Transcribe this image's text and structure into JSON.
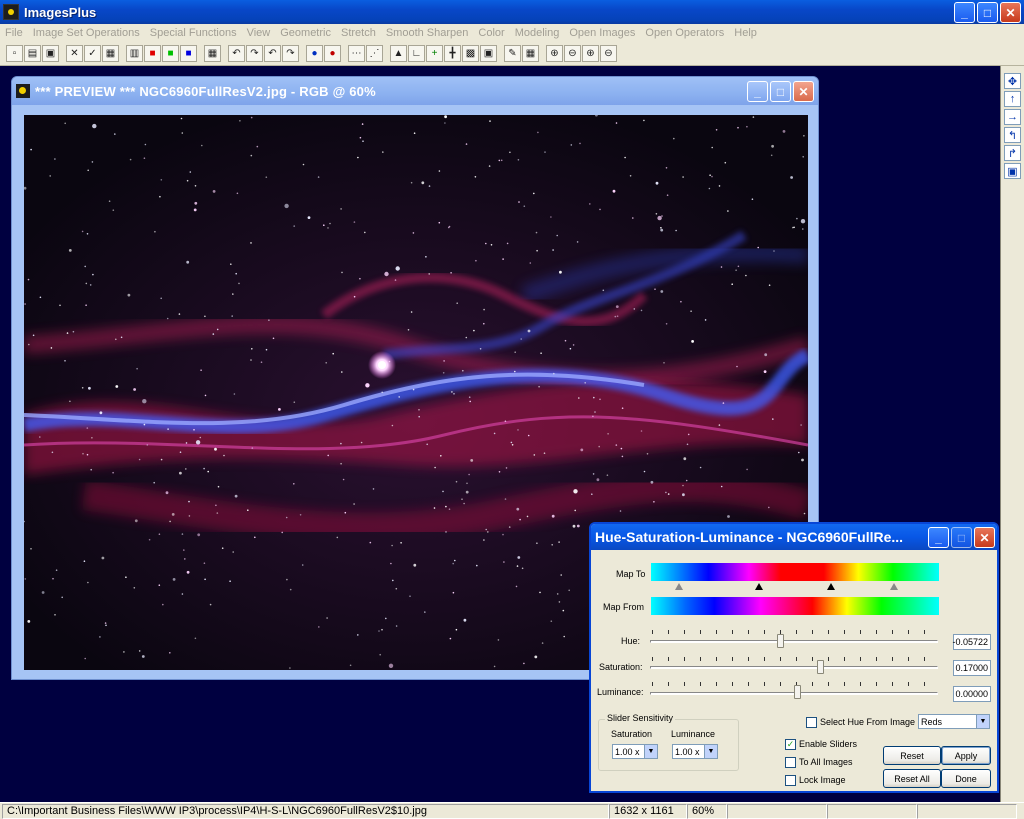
{
  "app": {
    "title": "ImagesPlus",
    "menu": [
      "File",
      "Image Set Operations",
      "Special Functions",
      "View",
      "Geometric",
      "Stretch",
      "Smooth Sharpen",
      "Color",
      "Modeling",
      "Open Images",
      "Open Operators",
      "Help"
    ]
  },
  "toolbar": {
    "icons": [
      "new-icon",
      "open-icon",
      "save-icon",
      "delete-icon",
      "check-icon",
      "print-icon",
      "rgb-channels-icon",
      "red-channel-icon",
      "green-channel-icon",
      "blue-channel-icon",
      "grid-icon",
      "undo-icon",
      "redo-icon",
      "undo-all-icon",
      "redo-all-icon",
      "dot-icon",
      "dot-red-icon",
      "dash-icon",
      "points-icon",
      "triangle-icon",
      "corner-icon",
      "plus-icon",
      "crosshair-icon",
      "calculator-icon",
      "palette-icon",
      "pencil-icon",
      "checker-icon",
      "zoom-in-icon",
      "zoom-out-icon",
      "zoom-fit-icon",
      "zoom-actual-icon"
    ],
    "glyphs": [
      "▫",
      "▤",
      "▣",
      "✕",
      "✓",
      "▦",
      "▥",
      "■",
      "■",
      "■",
      "▦",
      "↶",
      "↷",
      "↶",
      "↷",
      "●",
      "●",
      "⋯",
      "⋰",
      "▲",
      "∟",
      "+",
      "╋",
      "▩",
      "▣",
      "✎",
      "▦",
      "⊕",
      "⊖",
      "⊕",
      "⊖"
    ]
  },
  "dock": {
    "buttons": [
      {
        "name": "move-icon",
        "glyph": "✥"
      },
      {
        "name": "arrow-up-icon",
        "glyph": "↑"
      },
      {
        "name": "arrow-right-icon",
        "glyph": "→"
      },
      {
        "name": "rotate-left-icon",
        "glyph": "↰"
      },
      {
        "name": "rotate-right-icon",
        "glyph": "↱"
      },
      {
        "name": "frame-icon",
        "glyph": "▣"
      }
    ]
  },
  "preview": {
    "title": "*** PREVIEW *** NGC6960FullResV2.jpg - RGB @ 60%"
  },
  "hsl_dialog": {
    "title": "Hue-Saturation-Luminance - NGC6960FullRe...",
    "map_to_label": "Map To",
    "map_from_label": "Map From",
    "hue_label": "Hue:",
    "hue_value": "-0.05722",
    "hue_level": 0.45,
    "saturation_label": "Saturation:",
    "saturation_value": "0.17000",
    "saturation_level": 0.59,
    "luminance_label": "Luminance:",
    "luminance_value": "0.00000",
    "luminance_level": 0.51,
    "select_hue_label": "Select Hue From Image",
    "hue_range_selected": "Reds",
    "sensitivity_group": "Slider Sensitivity",
    "sensitivity_saturation_label": "Saturation",
    "sensitivity_luminance_label": "Luminance",
    "sensitivity_saturation_value": "1.00 x",
    "sensitivity_luminance_value": "1.00 x",
    "enable_sliders_label": "Enable Sliders",
    "enable_sliders_checked": true,
    "to_all_images_label": "To All Images",
    "lock_image_label": "Lock Image",
    "reset_label": "Reset",
    "apply_label": "Apply",
    "reset_all_label": "Reset All",
    "done_label": "Done"
  },
  "status": {
    "path": "C:\\Important Business Files\\WWW IP3\\process\\IP4\\H-S-L\\NGC6960FullResV2$10.jpg",
    "dimensions": "1632 x 1161",
    "zoom": "60%"
  }
}
